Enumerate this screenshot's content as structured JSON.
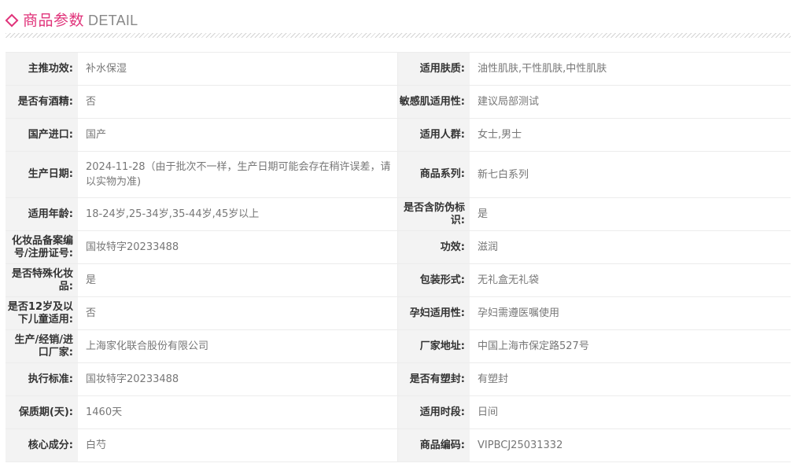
{
  "header": {
    "title_cn": "商品参数",
    "title_en": "DETAIL"
  },
  "colors": {
    "accent": "#e0337a",
    "label_bg": "#f3f3f3",
    "border": "#ececec"
  },
  "rows": [
    {
      "left": {
        "label": "主推功效:",
        "value": "补水保湿"
      },
      "right": {
        "label": "适用肤质:",
        "value": "油性肌肤,干性肌肤,中性肌肤"
      }
    },
    {
      "left": {
        "label": "是否有酒精:",
        "value": "否"
      },
      "right": {
        "label": "敏感肌适用性:",
        "value": "建议局部测试"
      }
    },
    {
      "left": {
        "label": "国产进口:",
        "value": "国产"
      },
      "right": {
        "label": "适用人群:",
        "value": "女士,男士"
      }
    },
    {
      "left": {
        "label": "生产日期:",
        "value": "2024-11-28（由于批次不一样，生产日期可能会存在稍许误差，请以实物为准)"
      },
      "right": {
        "label": "商品系列:",
        "value": "新七白系列"
      }
    },
    {
      "left": {
        "label": "适用年龄:",
        "value": "18-24岁,25-34岁,35-44岁,45岁以上"
      },
      "right": {
        "label": "是否含防伪标识:",
        "value": "是"
      }
    },
    {
      "left": {
        "label": "化妆品备案编号/注册证号:",
        "value": "国妆特字20233488"
      },
      "right": {
        "label": "功效:",
        "value": "滋润"
      }
    },
    {
      "left": {
        "label": "是否特殊化妆品:",
        "value": "是"
      },
      "right": {
        "label": "包装形式:",
        "value": "无礼盒无礼袋"
      }
    },
    {
      "left": {
        "label": "是否12岁及以下儿童适用:",
        "value": "否"
      },
      "right": {
        "label": "孕妇适用性:",
        "value": "孕妇需遵医嘱使用"
      }
    },
    {
      "left": {
        "label": "生产/经销/进口厂家:",
        "value": "上海家化联合股份有限公司"
      },
      "right": {
        "label": "厂家地址:",
        "value": "中国上海市保定路527号"
      }
    },
    {
      "left": {
        "label": "执行标准:",
        "value": "国妆特字20233488"
      },
      "right": {
        "label": "是否有塑封:",
        "value": "有塑封"
      }
    },
    {
      "left": {
        "label": "保质期(天):",
        "value": "1460天"
      },
      "right": {
        "label": "适用时段:",
        "value": "日间"
      }
    },
    {
      "left": {
        "label": "核心成分:",
        "value": "白芍"
      },
      "right": {
        "label": "商品编码:",
        "value": "VIPBCJ25031332"
      }
    }
  ]
}
